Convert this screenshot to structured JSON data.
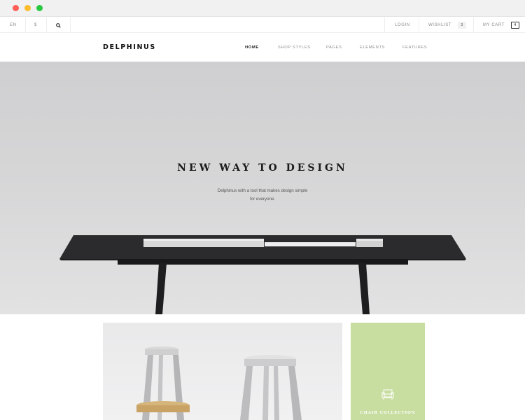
{
  "topbar": {
    "language": "EN",
    "currency": "$",
    "search_icon": "search-icon",
    "login_label": "LOGIN",
    "wishlist_label": "WISHLIST",
    "wishlist_count": "3",
    "cart_label": "MY CART",
    "cart_count": "4"
  },
  "header": {
    "logo": "DELPHINUS",
    "nav": [
      {
        "label": "HOME",
        "active": true
      },
      {
        "label": "SHOP STYLES"
      },
      {
        "label": "PAGES"
      },
      {
        "label": "ELEMENTS"
      },
      {
        "label": "FEATURES"
      }
    ]
  },
  "hero": {
    "title": "NEW WAY TO DESIGN",
    "subtitle_line1": "Delphinus with a tool that makes design simple",
    "subtitle_line2": "for everyone."
  },
  "collections": {
    "chair_label": "CHAIR COLLECTION",
    "chair_icon": "armchair-icon",
    "accent_color": "#c8dda0"
  },
  "colors": {
    "hero_bg": "#d3d3d5",
    "text_dark": "#1b1b1b"
  }
}
